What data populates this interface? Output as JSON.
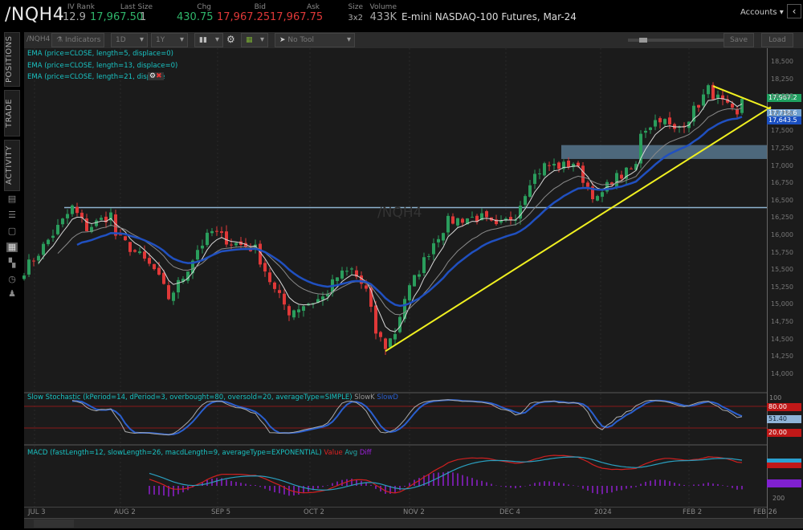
{
  "header": {
    "symbol": "/NQH4",
    "iv_rank_label": "IV Rank",
    "iv_rank": "12.9",
    "last_size_label": "Last Size",
    "last": "17,967.50",
    "last_size": "1",
    "chg_label": "Chg",
    "chg": "430.75",
    "bid_label": "Bid",
    "bid": "17,967.25",
    "ask_label": "Ask",
    "ask": "17,967.75",
    "size_label": "Size",
    "size": "3x2",
    "volume_label": "Volume",
    "volume": "433K",
    "description": "E-mini NASDAQ-100 Futures, Mar-24",
    "accounts": "Accounts"
  },
  "sidebar": {
    "tabs": [
      "POSITIONS",
      "TRADE",
      "ACTIVITY"
    ]
  },
  "toolbar": {
    "symbol": "/NQH4",
    "indicators": "Indicators",
    "aggregation": "1D",
    "timeframe": "1Y",
    "tool": "No Tool",
    "save": "Save",
    "load": "Load"
  },
  "studies": {
    "ema": [
      "EMA (price=CLOSE, length=5, displace=0)",
      "EMA (price=CLOSE, length=13, displace=0)",
      "EMA (price=CLOSE, length=21, displace"
    ],
    "watermark": "/NQH4",
    "stoch_title": "Slow Stochastic (kPeriod=14, dPeriod=3, overbought=80, oversold=20, averageType=SIMPLE)",
    "stoch_k": "SlowK",
    "stoch_d": "SlowD",
    "stoch_axis": "100",
    "stoch_ob": "80.00",
    "stoch_val": "51.40",
    "stoch_os": "20.00",
    "macd_title": "MACD (fastLength=12, slowLength=26, macdLength=9, averageType=EXPONENTIAL)",
    "macd_value": "Value",
    "macd_avg": "Avg",
    "macd_diff": "Diff",
    "macd_axis": "200"
  },
  "price_labels": {
    "last": "17,967.2",
    "ema_a": "17,718.6",
    "ema_b": "17,643.5"
  },
  "colors": {
    "up": "#2a9d5c",
    "down": "#e03838",
    "ema5": "#d8d8d8",
    "ema13": "#8a8a8a",
    "ema21": "#2050c0",
    "trend": "#f0f020",
    "level": "#8fb4d0",
    "zone": "#5a7c95"
  },
  "chart_data": {
    "type": "candlestick",
    "title": "/NQH4",
    "yticks": [
      "18,500",
      "18,250",
      "18,000",
      "17,750",
      "17,500",
      "17,250",
      "17,000",
      "16,750",
      "16,500",
      "16,250",
      "16,000",
      "15,750",
      "15,500",
      "15,250",
      "15,000",
      "14,750",
      "14,500",
      "14,250",
      "14,000"
    ],
    "ylim": [
      14000,
      18500
    ],
    "xticks": [
      "JUL 3",
      "AUG 2",
      "SEP 5",
      "OCT 2",
      "NOV 2",
      "DEC 4",
      "2024",
      "FEB 2",
      "FEB 26"
    ],
    "close_keypoints": [
      [
        0,
        15500
      ],
      [
        3,
        15750
      ],
      [
        8,
        16200
      ],
      [
        10,
        16400
      ],
      [
        13,
        16100
      ],
      [
        18,
        16300
      ],
      [
        19,
        16000
      ],
      [
        24,
        15700
      ],
      [
        27,
        15500
      ],
      [
        30,
        15100
      ],
      [
        33,
        15400
      ],
      [
        36,
        15800
      ],
      [
        39,
        16050
      ],
      [
        43,
        15900
      ],
      [
        48,
        15800
      ],
      [
        52,
        15200
      ],
      [
        55,
        14900
      ],
      [
        58,
        15000
      ],
      [
        62,
        15100
      ],
      [
        65,
        15400
      ],
      [
        68,
        15500
      ],
      [
        71,
        15200
      ],
      [
        73,
        14600
      ],
      [
        75,
        14400
      ],
      [
        77,
        14600
      ],
      [
        79,
        15100
      ],
      [
        82,
        15500
      ],
      [
        85,
        15900
      ],
      [
        88,
        16200
      ],
      [
        92,
        16250
      ],
      [
        95,
        16250
      ],
      [
        98,
        16100
      ],
      [
        102,
        16300
      ],
      [
        105,
        16800
      ],
      [
        108,
        17000
      ],
      [
        112,
        17000
      ],
      [
        114,
        17050
      ],
      [
        117,
        16700
      ],
      [
        119,
        16500
      ],
      [
        122,
        16800
      ],
      [
        125,
        16900
      ],
      [
        127,
        17000
      ],
      [
        128,
        17500
      ],
      [
        132,
        17700
      ],
      [
        135,
        17500
      ],
      [
        138,
        17700
      ],
      [
        140,
        17900
      ],
      [
        142,
        18100
      ],
      [
        145,
        17900
      ],
      [
        148,
        17700
      ],
      [
        149,
        17967.5
      ]
    ],
    "horizontal_level": 16400,
    "zone": [
      17100,
      17300
    ],
    "trendline_up": [
      [
        75,
        14330
      ],
      [
        155,
        17850
      ]
    ],
    "trendline_down": [
      [
        143,
        18150
      ],
      [
        155,
        17820
      ]
    ]
  }
}
